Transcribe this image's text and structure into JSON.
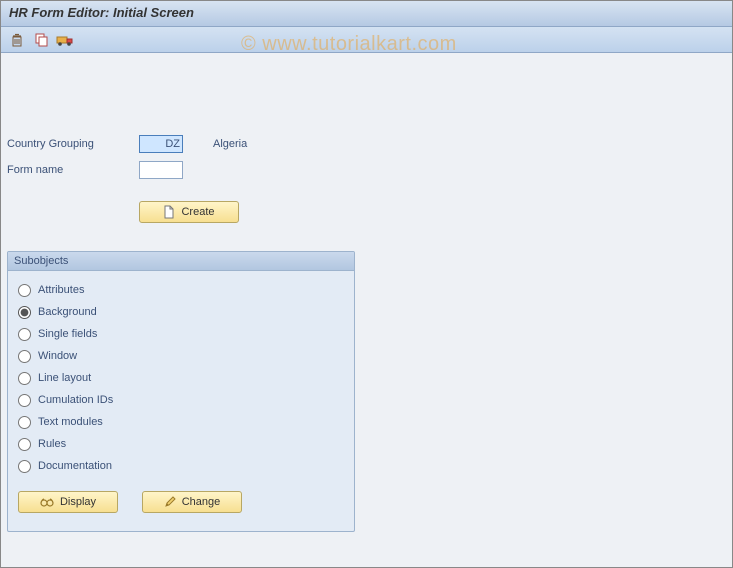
{
  "header": {
    "title": "HR Form Editor: Initial Screen"
  },
  "toolbar": {
    "icons": {
      "delete": "delete-icon",
      "copy": "copy-icon",
      "transport": "transport-icon"
    }
  },
  "fields": {
    "country_grouping": {
      "label": "Country Grouping",
      "value": "DZ",
      "desc": "Algeria"
    },
    "form_name": {
      "label": "Form name",
      "value": ""
    }
  },
  "buttons": {
    "create": "Create",
    "display": "Display",
    "change": "Change"
  },
  "subobjects": {
    "title": "Subobjects",
    "selected": "Background",
    "options": [
      "Attributes",
      "Background",
      "Single fields",
      "Window",
      "Line layout",
      "Cumulation IDs",
      "Text modules",
      "Rules",
      "Documentation"
    ]
  },
  "watermark": "© www.tutorialkart.com"
}
